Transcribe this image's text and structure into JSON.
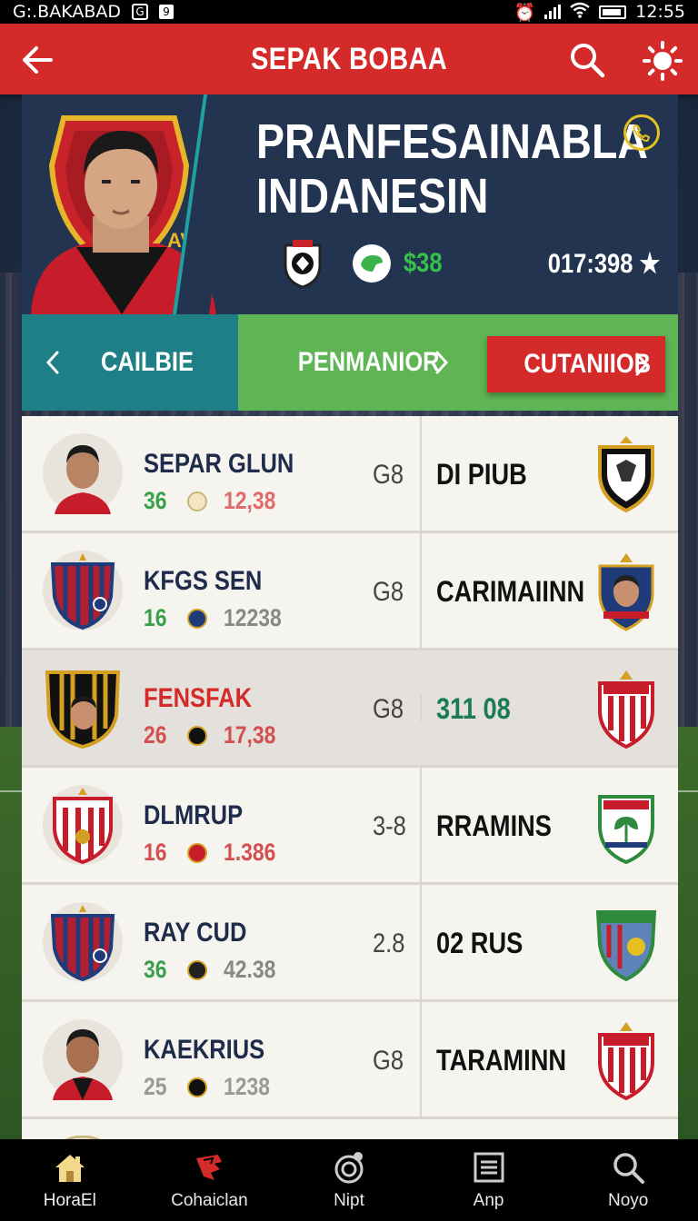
{
  "status_bar": {
    "left_text": "G:.BAKABAD",
    "icon1": "G",
    "icon2": "9",
    "right_text": "12:55"
  },
  "app_bar": {
    "title": "SEPAK BOBAA"
  },
  "hero": {
    "headline_line1": "PRANFESAINABLA",
    "headline_line2": "INDANESIN",
    "money": "$38",
    "score": "017:398 ★"
  },
  "tabs": {
    "tab1": "CAILBIE",
    "tab2": "PENMANIOR",
    "tab3": "CUTANIIOB"
  },
  "rows": [
    {
      "name": "SEPAR GLUN",
      "n1": "36",
      "n2": "12,38",
      "mid": "G8",
      "right": "DI PIUB"
    },
    {
      "name": "KFGS SEN",
      "n1": "16",
      "n2": "12238",
      "mid": "G8",
      "right": "CARIMAIINN"
    },
    {
      "name": "FENSFAK",
      "n1": "26",
      "n2": "17,38",
      "mid": "G8",
      "right": "311 08"
    },
    {
      "name": "DLMRUP",
      "n1": "16",
      "n2": "1.386",
      "mid": "3-8",
      "right": "RRAMINS"
    },
    {
      "name": "RAY CUD",
      "n1": "36",
      "n2": "42.38",
      "mid": "2.8",
      "right": "02 RUS"
    },
    {
      "name": "KAEKRIUS",
      "n1": "25",
      "n2": "1238",
      "mid": "G8",
      "right": "TARAMINN"
    }
  ],
  "bottom_nav": [
    {
      "label": "HoraEl",
      "icon": "home-icon"
    },
    {
      "label": "Cohaiclan",
      "icon": "competition-icon"
    },
    {
      "label": "Nipt",
      "icon": "ball-icon"
    },
    {
      "label": "Anp",
      "icon": "list-icon"
    },
    {
      "label": "Noyo",
      "icon": "search-icon"
    }
  ],
  "colors": {
    "primary_red": "#d42a2a",
    "teal": "#1e7f86",
    "green": "#5fb554",
    "navy": "#22344f"
  }
}
